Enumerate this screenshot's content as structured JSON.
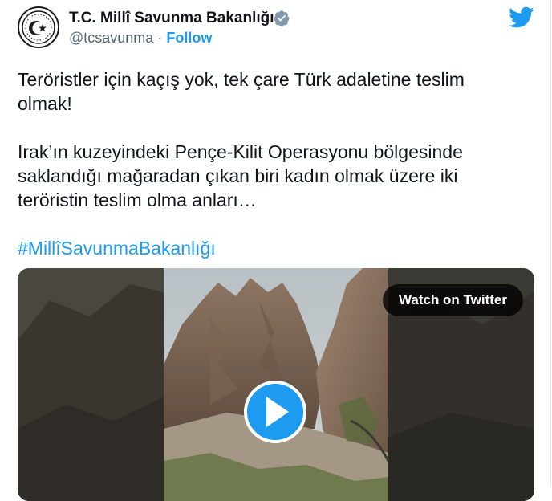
{
  "account": {
    "display_name": "T.C. Millî Savunma Bakanlığı",
    "handle": "@tcsavunma",
    "separator": "·",
    "follow_label": "Follow"
  },
  "tweet": {
    "paragraph1": "Teröristler için kaçış yok, tek çare Türk adaletine teslim olmak!",
    "paragraph2": "Irak’ın kuzeyindeki Pençe-Kilit Operasyonu bölgesinde saklandığı mağaradan çıkan biri kadın olmak üzere iki teröristin teslim olma anları…",
    "hashtag": "#MillîSavunmaBakanlığı"
  },
  "media": {
    "watch_label": "Watch on Twitter"
  },
  "colors": {
    "twitter_blue": "#1d9bf0",
    "text": "#0f1419",
    "secondary": "#536471"
  },
  "icons": {
    "verified": "verified-badge-icon",
    "twitter": "twitter-bird-icon",
    "play": "play-icon"
  }
}
